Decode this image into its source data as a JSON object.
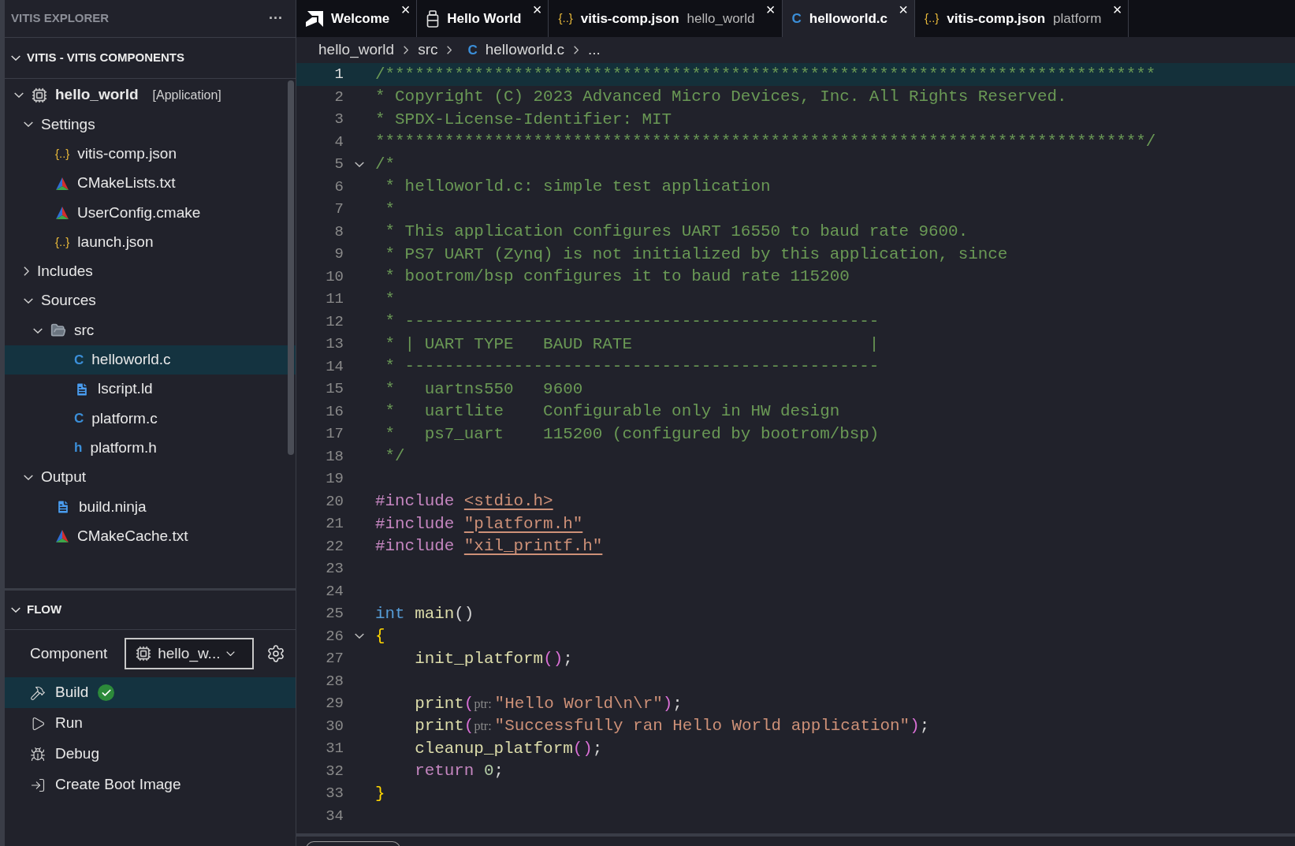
{
  "explorer": {
    "title": "VITIS EXPLORER",
    "more": "···",
    "section": "VITIS - VITIS COMPONENTS",
    "section_expanded": true,
    "tree": [
      {
        "label": "hello_world",
        "kind": "chip",
        "tag": "[Application]",
        "expanded": true,
        "selected": false,
        "children": [
          {
            "label": "Settings",
            "kind": "group",
            "expanded": true,
            "selected": false,
            "children": [
              {
                "label": "vitis-comp.json",
                "kind": "json",
                "glyph": "{..}",
                "selected": false
              },
              {
                "label": "CMakeLists.txt",
                "kind": "cmake",
                "selected": false
              },
              {
                "label": "UserConfig.cmake",
                "kind": "cmake",
                "selected": false
              },
              {
                "label": "launch.json",
                "kind": "json",
                "glyph": "{..}",
                "selected": false
              }
            ]
          },
          {
            "label": "Includes",
            "kind": "group",
            "expanded": false,
            "selected": false
          },
          {
            "label": "Sources",
            "kind": "group",
            "expanded": true,
            "selected": false,
            "children": [
              {
                "label": "src",
                "kind": "folder",
                "expanded": true,
                "selected": false,
                "children": [
                  {
                    "label": "helloworld.c",
                    "kind": "c",
                    "glyph": "C",
                    "selected": true
                  },
                  {
                    "label": "lscript.ld",
                    "kind": "doc",
                    "selected": false
                  },
                  {
                    "label": "platform.c",
                    "kind": "c",
                    "glyph": "C",
                    "selected": false
                  },
                  {
                    "label": "platform.h",
                    "kind": "h",
                    "glyph": "h",
                    "selected": false
                  }
                ]
              }
            ]
          },
          {
            "label": "Output",
            "kind": "group",
            "expanded": true,
            "selected": false,
            "children": [
              {
                "label": "build.ninja",
                "kind": "doc",
                "selected": false
              },
              {
                "label": "CMakeCache.txt",
                "kind": "cmake",
                "selected": false
              }
            ]
          }
        ]
      }
    ]
  },
  "flow": {
    "title": "FLOW",
    "expanded": true,
    "component_label": "Component",
    "component_value": "hello_w...",
    "actions": [
      {
        "label": "Build",
        "kind": "build",
        "selected": true,
        "built": true
      },
      {
        "label": "Run",
        "kind": "run",
        "selected": false,
        "built": false
      },
      {
        "label": "Debug",
        "kind": "debug",
        "selected": false,
        "built": false
      },
      {
        "label": "Create Boot Image",
        "kind": "boot",
        "selected": false,
        "built": false
      }
    ]
  },
  "tabs": [
    {
      "label": "Welcome",
      "kind": "amd",
      "selected": false,
      "close": "×"
    },
    {
      "label": "Hello World",
      "kind": "jar",
      "selected": false,
      "close": "×"
    },
    {
      "label": "vitis-comp.json",
      "description": "hello_world",
      "kind": "json",
      "glyph": "{..}",
      "selected": false,
      "close": "×"
    },
    {
      "label": "helloworld.c",
      "kind": "c",
      "glyph": "C",
      "selected": true,
      "close": "×"
    },
    {
      "label": "vitis-comp.json",
      "description": "platform",
      "kind": "json",
      "glyph": "{..}",
      "selected": false,
      "close": "×"
    }
  ],
  "breadcrumb": [
    {
      "label": "hello_world",
      "kind": "plain"
    },
    {
      "label": "src",
      "kind": "plain"
    },
    {
      "label": "helloworld.c",
      "kind": "c",
      "glyph": "C"
    },
    {
      "label": "...",
      "kind": "plain"
    }
  ],
  "lines": [
    {
      "n": "1",
      "selected": true,
      "fold": false,
      "tokens": [
        {
          "t": "/******************************************************************************",
          "kind": "comment"
        }
      ]
    },
    {
      "n": "2",
      "selected": false,
      "fold": false,
      "tokens": [
        {
          "t": "* Copyright (C) 2023 Advanced Micro Devices, Inc. All Rights Reserved.",
          "kind": "comment"
        }
      ]
    },
    {
      "n": "3",
      "selected": false,
      "fold": false,
      "tokens": [
        {
          "t": "* SPDX-License-Identifier: MIT",
          "kind": "comment"
        }
      ]
    },
    {
      "n": "4",
      "selected": false,
      "fold": false,
      "tokens": [
        {
          "t": "******************************************************************************/",
          "kind": "comment"
        }
      ]
    },
    {
      "n": "5",
      "selected": false,
      "fold": true,
      "tokens": [
        {
          "t": "/*",
          "kind": "comment"
        }
      ]
    },
    {
      "n": "6",
      "selected": false,
      "fold": false,
      "tokens": [
        {
          "t": " * helloworld.c: simple test application",
          "kind": "comment"
        }
      ]
    },
    {
      "n": "7",
      "selected": false,
      "fold": false,
      "tokens": [
        {
          "t": " *",
          "kind": "comment"
        }
      ]
    },
    {
      "n": "8",
      "selected": false,
      "fold": false,
      "tokens": [
        {
          "t": " * This application configures UART 16550 to baud rate 9600.",
          "kind": "comment"
        }
      ]
    },
    {
      "n": "9",
      "selected": false,
      "fold": false,
      "tokens": [
        {
          "t": " * PS7 UART (Zynq) is not initialized by this application, since",
          "kind": "comment"
        }
      ]
    },
    {
      "n": "10",
      "selected": false,
      "fold": false,
      "tokens": [
        {
          "t": " * bootrom/bsp configures it to baud rate 115200",
          "kind": "comment"
        }
      ]
    },
    {
      "n": "11",
      "selected": false,
      "fold": false,
      "tokens": [
        {
          "t": " *",
          "kind": "comment"
        }
      ]
    },
    {
      "n": "12",
      "selected": false,
      "fold": false,
      "tokens": [
        {
          "t": " * ------------------------------------------------",
          "kind": "comment"
        }
      ]
    },
    {
      "n": "13",
      "selected": false,
      "fold": false,
      "tokens": [
        {
          "t": " * | UART TYPE   BAUD RATE                        |",
          "kind": "comment"
        }
      ]
    },
    {
      "n": "14",
      "selected": false,
      "fold": false,
      "tokens": [
        {
          "t": " * ------------------------------------------------",
          "kind": "comment"
        }
      ]
    },
    {
      "n": "15",
      "selected": false,
      "fold": false,
      "tokens": [
        {
          "t": " *   uartns550   9600",
          "kind": "comment"
        }
      ]
    },
    {
      "n": "16",
      "selected": false,
      "fold": false,
      "tokens": [
        {
          "t": " *   uartlite    Configurable only in HW design",
          "kind": "comment"
        }
      ]
    },
    {
      "n": "17",
      "selected": false,
      "fold": false,
      "tokens": [
        {
          "t": " *   ps7_uart    115200 (configured by bootrom/bsp)",
          "kind": "comment"
        }
      ]
    },
    {
      "n": "18",
      "selected": false,
      "fold": false,
      "tokens": [
        {
          "t": " */",
          "kind": "comment"
        }
      ]
    },
    {
      "n": "19",
      "selected": false,
      "fold": false
    },
    {
      "n": "20",
      "selected": false,
      "fold": false,
      "tokens": [
        {
          "t": "#include ",
          "kind": "preproc"
        },
        {
          "t": "<stdio.h>",
          "kind": "include"
        }
      ]
    },
    {
      "n": "21",
      "selected": false,
      "fold": false,
      "tokens": [
        {
          "t": "#include ",
          "kind": "preproc"
        },
        {
          "t": "\"platform.h\"",
          "kind": "include"
        }
      ]
    },
    {
      "n": "22",
      "selected": false,
      "fold": false,
      "tokens": [
        {
          "t": "#include ",
          "kind": "preproc"
        },
        {
          "t": "\"xil_printf.h\"",
          "kind": "include"
        }
      ]
    },
    {
      "n": "23",
      "selected": false,
      "fold": false
    },
    {
      "n": "24",
      "selected": false,
      "fold": false
    },
    {
      "n": "25",
      "selected": false,
      "fold": false,
      "tokens": [
        {
          "t": "int ",
          "kind": "keyword"
        },
        {
          "t": "main",
          "kind": "function"
        },
        {
          "t": "()",
          "kind": "plain"
        }
      ]
    },
    {
      "n": "26",
      "selected": false,
      "fold": true,
      "tokens": [
        {
          "t": "{",
          "kind": "bracket1"
        }
      ]
    },
    {
      "n": "27",
      "selected": false,
      "fold": false,
      "tokens": [
        {
          "t": "    init_platform",
          "kind": "function"
        },
        {
          "t": "()",
          "kind": "bracket2"
        },
        {
          "t": ";",
          "kind": "plain"
        }
      ]
    },
    {
      "n": "28",
      "selected": false,
      "fold": false
    },
    {
      "n": "29",
      "selected": false,
      "fold": false,
      "tokens": [
        {
          "t": "    print",
          "kind": "function"
        },
        {
          "t": "(",
          "kind": "bracket2"
        },
        {
          "t": "ptr: ",
          "kind": "hint"
        },
        {
          "t": "\"Hello World\\n\\r\"",
          "kind": "string"
        },
        {
          "t": ")",
          "kind": "bracket2"
        },
        {
          "t": ";",
          "kind": "plain"
        }
      ]
    },
    {
      "n": "30",
      "selected": false,
      "fold": false,
      "tokens": [
        {
          "t": "    print",
          "kind": "function"
        },
        {
          "t": "(",
          "kind": "bracket2"
        },
        {
          "t": "ptr: ",
          "kind": "hint"
        },
        {
          "t": "\"Successfully ran Hello World application\"",
          "kind": "string"
        },
        {
          "t": ")",
          "kind": "bracket2"
        },
        {
          "t": ";",
          "kind": "plain"
        }
      ]
    },
    {
      "n": "31",
      "selected": false,
      "fold": false,
      "tokens": [
        {
          "t": "    cleanup_platform",
          "kind": "function"
        },
        {
          "t": "()",
          "kind": "bracket2"
        },
        {
          "t": ";",
          "kind": "plain"
        }
      ]
    },
    {
      "n": "32",
      "selected": false,
      "fold": false,
      "tokens": [
        {
          "t": "    return ",
          "kind": "control"
        },
        {
          "t": "0",
          "kind": "number"
        },
        {
          "t": ";",
          "kind": "plain"
        }
      ]
    },
    {
      "n": "33",
      "selected": false,
      "fold": false,
      "tokens": [
        {
          "t": "}",
          "kind": "bracket1"
        }
      ]
    },
    {
      "n": "34",
      "selected": false,
      "fold": false
    }
  ]
}
